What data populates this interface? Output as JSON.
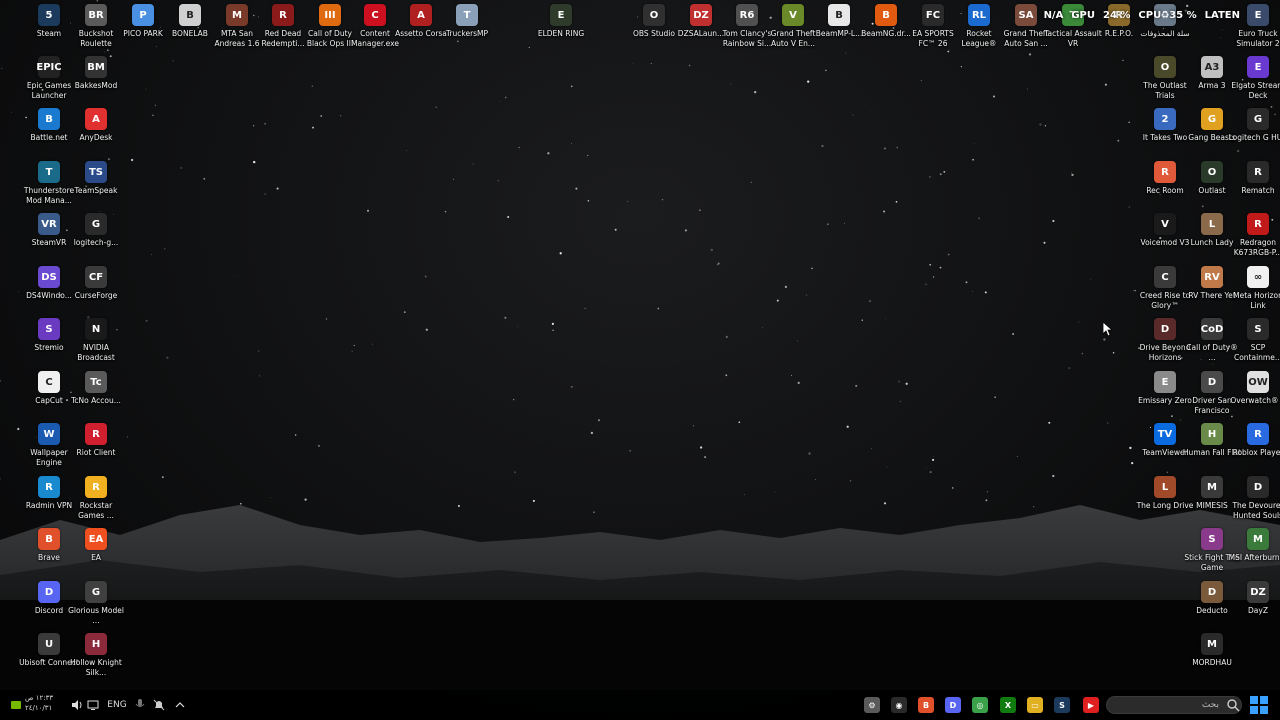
{
  "colors": {
    "taskbar_bg": "#0b0b0b",
    "accent": "#3aa0ff"
  },
  "performance_overlay": {
    "gpu_label": "GPU",
    "gpu_value": "24 %",
    "cpu_label": "CPU",
    "cpu_value": "35 %",
    "fps_value": "N/A",
    "latency_label": "LATEN"
  },
  "desktop_icons": [
    {
      "label": "Steam",
      "icon": "steam-icon",
      "color": "#1b3a5c",
      "glyph": "5"
    },
    {
      "label": "Buckshot Roulette",
      "icon": "buckshot-roulette-icon",
      "color": "#5a5a5a",
      "glyph": "BR"
    },
    {
      "label": "PICO PARK",
      "icon": "pico-park-icon",
      "color": "#4a90e2",
      "glyph": "P"
    },
    {
      "label": "BONELAB",
      "icon": "bonelab-icon",
      "color": "#d0d0d0",
      "glyph": "B"
    },
    {
      "label": "MTA San Andreas 1.6",
      "icon": "mta-icon",
      "color": "#7a3a2a",
      "glyph": "M"
    },
    {
      "label": "Red Dead Redempti...",
      "icon": "red-dead-icon",
      "color": "#8b1a1a",
      "glyph": "R"
    },
    {
      "label": "Call of Duty Black Ops III",
      "icon": "cod-bo3-icon",
      "color": "#e06a10",
      "glyph": "III"
    },
    {
      "label": "Content Manager.exe",
      "icon": "content-manager-icon",
      "color": "#cc1020",
      "glyph": "C"
    },
    {
      "label": "Assetto Corsa",
      "icon": "assetto-corsa-icon",
      "color": "#b02020",
      "glyph": "A"
    },
    {
      "label": "TruckersMP",
      "icon": "truckersmp-icon",
      "color": "#8aa0b8",
      "glyph": "T"
    },
    {
      "label": "ELDEN RING",
      "icon": "elden-ring-icon",
      "color": "#2e3a2a",
      "glyph": "E"
    },
    {
      "label": "OBS Studio",
      "icon": "obs-icon",
      "color": "#303030",
      "glyph": "O"
    },
    {
      "label": "DZSALaun...",
      "icon": "dzsa-icon",
      "color": "#c03030",
      "glyph": "DZ"
    },
    {
      "label": "Tom Clancy's Rainbow Si...",
      "icon": "rainbow-six-icon",
      "color": "#505050",
      "glyph": "R6"
    },
    {
      "label": "Grand Theft Auto V En...",
      "icon": "gta5-icon",
      "color": "#6a8a2a",
      "glyph": "V"
    },
    {
      "label": "BeamMP-L...",
      "icon": "beammp-icon",
      "color": "#e8e8e8",
      "glyph": "B"
    },
    {
      "label": "BeamNG.dr...",
      "icon": "beamng-icon",
      "color": "#e05a10",
      "glyph": "B"
    },
    {
      "label": "EA SPORTS FC™ 26",
      "icon": "ea-fc-icon",
      "color": "#2a2a2a",
      "glyph": "FC"
    },
    {
      "label": "Rocket League®",
      "icon": "rocket-league-icon",
      "color": "#1a6ad0",
      "glyph": "RL"
    },
    {
      "label": "Grand Theft Auto San ...",
      "icon": "gta-sa-icon",
      "color": "#7a4a3a",
      "glyph": "SA"
    },
    {
      "label": "Tactical Assault VR",
      "icon": "tactical-assault-icon",
      "color": "#3a8a3a",
      "glyph": "T"
    },
    {
      "label": "R.E.P.O.",
      "icon": "repo-icon",
      "color": "#8a6a2a",
      "glyph": "R"
    },
    {
      "label": "سلة المحذوفات",
      "icon": "recycle-bin-icon",
      "color": "#6a7a8a",
      "glyph": "♻"
    },
    {
      "label": "Euro Truck Simulator 2",
      "icon": "ets2-icon",
      "color": "#3a4a6a",
      "glyph": "E"
    },
    {
      "label": "Epic Games Launcher",
      "icon": "epic-games-icon",
      "color": "#222222",
      "glyph": "EPIC"
    },
    {
      "label": "BakkesMod",
      "icon": "bakkesmod-icon",
      "color": "#333333",
      "glyph": "BM"
    },
    {
      "label": "Battle.net",
      "icon": "battlenet-icon",
      "color": "#1a7ad0",
      "glyph": "B"
    },
    {
      "label": "AnyDesk",
      "icon": "anydesk-icon",
      "color": "#e03030",
      "glyph": "A"
    },
    {
      "label": "Thunderstore Mod Mana...",
      "icon": "thunderstore-icon",
      "color": "#1a6a8a",
      "glyph": "T"
    },
    {
      "label": "TeamSpeak",
      "icon": "teamspeak-icon",
      "color": "#2a4a8a",
      "glyph": "TS"
    },
    {
      "label": "SteamVR",
      "icon": "steamvr-icon",
      "color": "#3a5a8a",
      "glyph": "VR"
    },
    {
      "label": "logitech-g...",
      "icon": "logitech-g-icon",
      "color": "#2a2a2a",
      "glyph": "G"
    },
    {
      "label": "DS4Windo...",
      "icon": "ds4windows-icon",
      "color": "#6a4ad0",
      "glyph": "DS"
    },
    {
      "label": "CurseForge",
      "icon": "curseforge-icon",
      "color": "#3a3a3a",
      "glyph": "CF"
    },
    {
      "label": "Stremio",
      "icon": "stremio-icon",
      "color": "#6a3ac0",
      "glyph": "S"
    },
    {
      "label": "NVIDIA Broadcast",
      "icon": "nvidia-broadcast-icon",
      "color": "#1a1a1a",
      "glyph": "N"
    },
    {
      "label": "CapCut",
      "icon": "capcut-icon",
      "color": "#f0f0f0",
      "glyph": "C"
    },
    {
      "label": "TcNo Accou...",
      "icon": "tcno-icon",
      "color": "#5a5a5a",
      "glyph": "Tc"
    },
    {
      "label": "Wallpaper Engine",
      "icon": "wallpaper-engine-icon",
      "color": "#1a5ab0",
      "glyph": "W"
    },
    {
      "label": "Riot Client",
      "icon": "riot-client-icon",
      "color": "#d02030",
      "glyph": "R"
    },
    {
      "label": "Radmin VPN",
      "icon": "radmin-vpn-icon",
      "color": "#1a8ad0",
      "glyph": "R"
    },
    {
      "label": "Rockstar Games ...",
      "icon": "rockstar-icon",
      "color": "#f0b020",
      "glyph": "R"
    },
    {
      "label": "Brave",
      "icon": "brave-icon",
      "color": "#e0502a",
      "glyph": "B"
    },
    {
      "label": "EA",
      "icon": "ea-icon",
      "color": "#f05020",
      "glyph": "EA"
    },
    {
      "label": "Discord",
      "icon": "discord-icon",
      "color": "#5865f2",
      "glyph": "D"
    },
    {
      "label": "Glorious Model ...",
      "icon": "glorious-icon",
      "color": "#404040",
      "glyph": "G"
    },
    {
      "label": "Ubisoft Connect",
      "icon": "ubisoft-icon",
      "color": "#3a3a3a",
      "glyph": "U"
    },
    {
      "label": "Hollow Knight Silk...",
      "icon": "hollow-knight-icon",
      "color": "#8a2a3a",
      "glyph": "H"
    },
    {
      "label": "The Outlast Trials",
      "icon": "outlast-trials-icon",
      "color": "#4a4a2a",
      "glyph": "O"
    },
    {
      "label": "Arma 3",
      "icon": "arma3-icon",
      "color": "#c0c0c0",
      "glyph": "A3"
    },
    {
      "label": "Elgato Stream Deck",
      "icon": "elgato-icon",
      "color": "#6a3ad0",
      "glyph": "E"
    },
    {
      "label": "It Takes Two",
      "icon": "it-takes-two-icon",
      "color": "#3a6ac0",
      "glyph": "2"
    },
    {
      "label": "Gang Beasts",
      "icon": "gang-beasts-icon",
      "color": "#e0a020",
      "glyph": "G"
    },
    {
      "label": "Logitech G HUB",
      "icon": "logitech-ghub-icon",
      "color": "#2a2a2a",
      "glyph": "G"
    },
    {
      "label": "Rec Room",
      "icon": "rec-room-icon",
      "color": "#e05a3a",
      "glyph": "R"
    },
    {
      "label": "Outlast",
      "icon": "outlast-icon",
      "color": "#2a3a2a",
      "glyph": "O"
    },
    {
      "label": "Rematch",
      "icon": "rematch-icon",
      "color": "#2a2a2a",
      "glyph": "R"
    },
    {
      "label": "Voicemod V3",
      "icon": "voicemod-icon",
      "color": "#1a1a1a",
      "glyph": "V"
    },
    {
      "label": "Lunch Lady",
      "icon": "lunch-lady-icon",
      "color": "#8a6a4a",
      "glyph": "L"
    },
    {
      "label": "Redragon K673RGB-P...",
      "icon": "redragon-icon",
      "color": "#c01a1a",
      "glyph": "R"
    },
    {
      "label": "Creed Rise to Glory™",
      "icon": "creed-icon",
      "color": "#3a3a3a",
      "glyph": "C"
    },
    {
      "label": "RV There Yet",
      "icon": "rv-there-yet-icon",
      "color": "#c07a4a",
      "glyph": "RV"
    },
    {
      "label": "Meta Horizon Link",
      "icon": "meta-horizon-icon",
      "color": "#f0f0f0",
      "glyph": "∞"
    },
    {
      "label": "Drive Beyond Horizons",
      "icon": "drive-beyond-icon",
      "color": "#5a2a2a",
      "glyph": "D"
    },
    {
      "label": "Call of Duty® ...",
      "icon": "call-of-duty-icon",
      "color": "#3a3a3a",
      "glyph": "CoD"
    },
    {
      "label": "SCP Containme...",
      "icon": "scp-icon",
      "color": "#2a2a2a",
      "glyph": "S"
    },
    {
      "label": "Emissary Zero",
      "icon": "emissary-zero-icon",
      "color": "#8a8a8a",
      "glyph": "E"
    },
    {
      "label": "Driver San Francisco",
      "icon": "driver-sf-icon",
      "color": "#4a4a4a",
      "glyph": "D"
    },
    {
      "label": "Overwatch® 2",
      "icon": "overwatch-icon",
      "color": "#e0e0e0",
      "glyph": "OW"
    },
    {
      "label": "TeamViewer",
      "icon": "teamviewer-icon",
      "color": "#0a6ae0",
      "glyph": "TV"
    },
    {
      "label": "Human Fall Flat",
      "icon": "human-fall-flat-icon",
      "color": "#6a8a4a",
      "glyph": "H"
    },
    {
      "label": "Roblox Player",
      "icon": "roblox-icon",
      "color": "#2a6ae0",
      "glyph": "R"
    },
    {
      "label": "The Long Drive",
      "icon": "long-drive-icon",
      "color": "#a04a2a",
      "glyph": "L"
    },
    {
      "label": "MIMESIS",
      "icon": "mimesis-icon",
      "color": "#3a3a3a",
      "glyph": "M"
    },
    {
      "label": "The Devourer Hunted Souls",
      "icon": "devourer-icon",
      "color": "#2a2a2a",
      "glyph": "D"
    },
    {
      "label": "Stick Fight The Game",
      "icon": "stick-fight-icon",
      "color": "#8a3a8a",
      "glyph": "S"
    },
    {
      "label": "MSI Afterburner",
      "icon": "msi-afterburner-icon",
      "color": "#3a7a3a",
      "glyph": "M"
    },
    {
      "label": "Deducto",
      "icon": "deducto-icon",
      "color": "#7a5a3a",
      "glyph": "D"
    },
    {
      "label": "DayZ",
      "icon": "dayz-icon",
      "color": "#3a3a3a",
      "glyph": "DZ"
    },
    {
      "label": "MORDHAU",
      "icon": "mordhau-icon",
      "color": "#2a2a2a",
      "glyph": "M"
    }
  ],
  "taskbar": {
    "language": "ENG",
    "clock_time": "١٢:٣٣ ص",
    "clock_date": "٢٤/١٠/٣١",
    "search_placeholder": "بحث",
    "pinned_apps": [
      {
        "name": "settings-app",
        "color": "#5a5a5a",
        "glyph": "⚙"
      },
      {
        "name": "steam-app",
        "color": "#2a2a2a",
        "glyph": "◉"
      },
      {
        "name": "brave-app",
        "color": "#e0502a",
        "glyph": "B"
      },
      {
        "name": "discord-app",
        "color": "#5865f2",
        "glyph": "D"
      },
      {
        "name": "chrome-app",
        "color": "#3aa04a",
        "glyph": "◎"
      },
      {
        "name": "xbox-app",
        "color": "#107c10",
        "glyph": "X"
      },
      {
        "name": "file-explorer-app",
        "color": "#e0b020",
        "glyph": "▭"
      },
      {
        "name": "steam-pinned-app",
        "color": "#1b3a5c",
        "glyph": "S"
      },
      {
        "name": "youtube-app",
        "color": "#e02020",
        "glyph": "▶"
      }
    ]
  }
}
